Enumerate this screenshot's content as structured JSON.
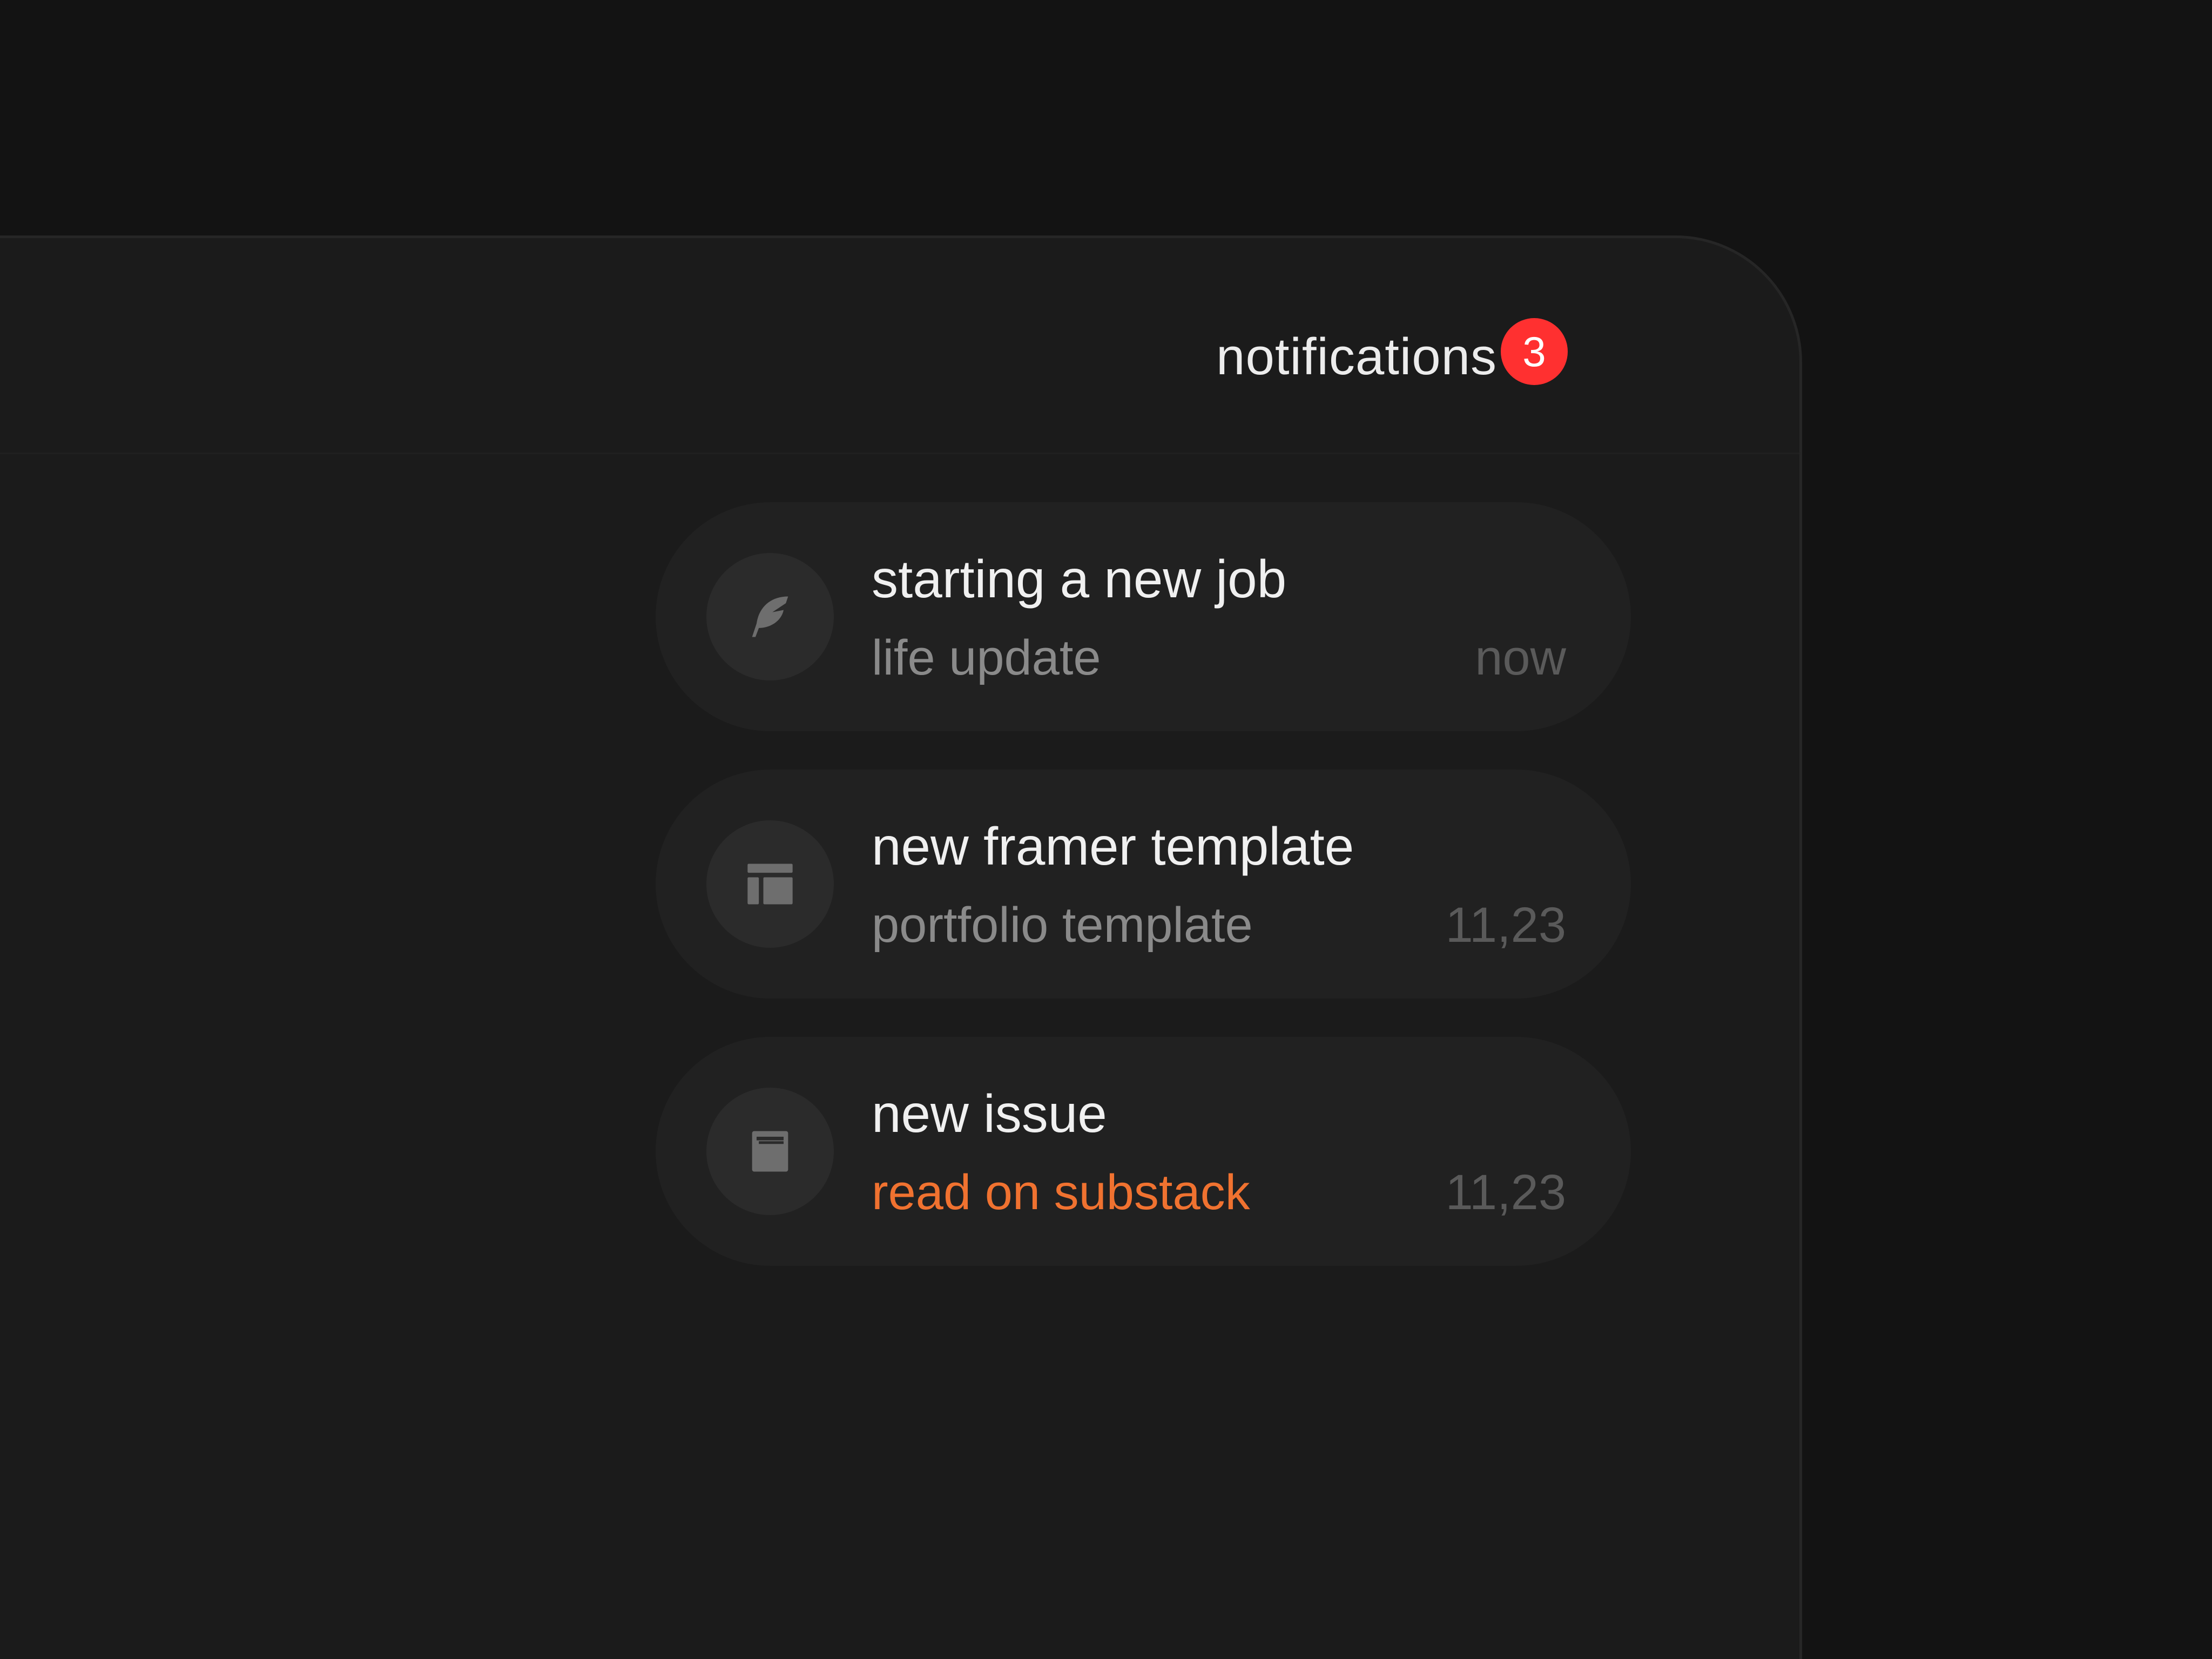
{
  "header": {
    "title": "notifications",
    "badge_count": "3",
    "badge_color": "#ff3030"
  },
  "notifications": [
    {
      "icon": "feather-icon",
      "title": "starting a new job",
      "subtitle": "life update",
      "time": "now"
    },
    {
      "icon": "layout-icon",
      "title": "new framer template",
      "subtitle": "portfolio template",
      "time": "11,23"
    },
    {
      "icon": "book-icon",
      "title": "new issue",
      "subtitle": "read on substack",
      "subtitle_color": "#f07230",
      "time": "11,23"
    }
  ]
}
